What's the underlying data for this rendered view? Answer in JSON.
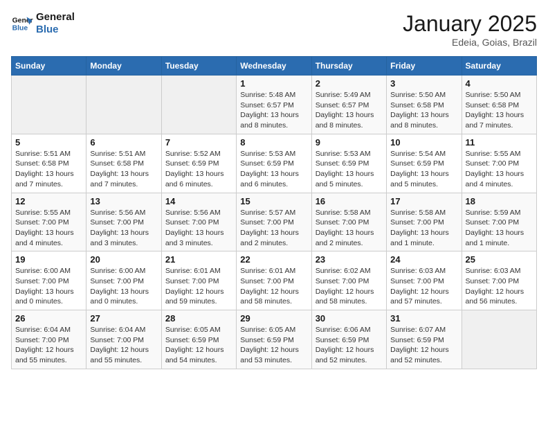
{
  "header": {
    "logo_line1": "General",
    "logo_line2": "Blue",
    "month_title": "January 2025",
    "subtitle": "Edeia, Goias, Brazil"
  },
  "days_of_week": [
    "Sunday",
    "Monday",
    "Tuesday",
    "Wednesday",
    "Thursday",
    "Friday",
    "Saturday"
  ],
  "weeks": [
    [
      {
        "day": "",
        "info": ""
      },
      {
        "day": "",
        "info": ""
      },
      {
        "day": "",
        "info": ""
      },
      {
        "day": "1",
        "info": "Sunrise: 5:48 AM\nSunset: 6:57 PM\nDaylight: 13 hours and 8 minutes."
      },
      {
        "day": "2",
        "info": "Sunrise: 5:49 AM\nSunset: 6:57 PM\nDaylight: 13 hours and 8 minutes."
      },
      {
        "day": "3",
        "info": "Sunrise: 5:50 AM\nSunset: 6:58 PM\nDaylight: 13 hours and 8 minutes."
      },
      {
        "day": "4",
        "info": "Sunrise: 5:50 AM\nSunset: 6:58 PM\nDaylight: 13 hours and 7 minutes."
      }
    ],
    [
      {
        "day": "5",
        "info": "Sunrise: 5:51 AM\nSunset: 6:58 PM\nDaylight: 13 hours and 7 minutes."
      },
      {
        "day": "6",
        "info": "Sunrise: 5:51 AM\nSunset: 6:58 PM\nDaylight: 13 hours and 7 minutes."
      },
      {
        "day": "7",
        "info": "Sunrise: 5:52 AM\nSunset: 6:59 PM\nDaylight: 13 hours and 6 minutes."
      },
      {
        "day": "8",
        "info": "Sunrise: 5:53 AM\nSunset: 6:59 PM\nDaylight: 13 hours and 6 minutes."
      },
      {
        "day": "9",
        "info": "Sunrise: 5:53 AM\nSunset: 6:59 PM\nDaylight: 13 hours and 5 minutes."
      },
      {
        "day": "10",
        "info": "Sunrise: 5:54 AM\nSunset: 6:59 PM\nDaylight: 13 hours and 5 minutes."
      },
      {
        "day": "11",
        "info": "Sunrise: 5:55 AM\nSunset: 7:00 PM\nDaylight: 13 hours and 4 minutes."
      }
    ],
    [
      {
        "day": "12",
        "info": "Sunrise: 5:55 AM\nSunset: 7:00 PM\nDaylight: 13 hours and 4 minutes."
      },
      {
        "day": "13",
        "info": "Sunrise: 5:56 AM\nSunset: 7:00 PM\nDaylight: 13 hours and 3 minutes."
      },
      {
        "day": "14",
        "info": "Sunrise: 5:56 AM\nSunset: 7:00 PM\nDaylight: 13 hours and 3 minutes."
      },
      {
        "day": "15",
        "info": "Sunrise: 5:57 AM\nSunset: 7:00 PM\nDaylight: 13 hours and 2 minutes."
      },
      {
        "day": "16",
        "info": "Sunrise: 5:58 AM\nSunset: 7:00 PM\nDaylight: 13 hours and 2 minutes."
      },
      {
        "day": "17",
        "info": "Sunrise: 5:58 AM\nSunset: 7:00 PM\nDaylight: 13 hours and 1 minute."
      },
      {
        "day": "18",
        "info": "Sunrise: 5:59 AM\nSunset: 7:00 PM\nDaylight: 13 hours and 1 minute."
      }
    ],
    [
      {
        "day": "19",
        "info": "Sunrise: 6:00 AM\nSunset: 7:00 PM\nDaylight: 13 hours and 0 minutes."
      },
      {
        "day": "20",
        "info": "Sunrise: 6:00 AM\nSunset: 7:00 PM\nDaylight: 13 hours and 0 minutes."
      },
      {
        "day": "21",
        "info": "Sunrise: 6:01 AM\nSunset: 7:00 PM\nDaylight: 12 hours and 59 minutes."
      },
      {
        "day": "22",
        "info": "Sunrise: 6:01 AM\nSunset: 7:00 PM\nDaylight: 12 hours and 58 minutes."
      },
      {
        "day": "23",
        "info": "Sunrise: 6:02 AM\nSunset: 7:00 PM\nDaylight: 12 hours and 58 minutes."
      },
      {
        "day": "24",
        "info": "Sunrise: 6:03 AM\nSunset: 7:00 PM\nDaylight: 12 hours and 57 minutes."
      },
      {
        "day": "25",
        "info": "Sunrise: 6:03 AM\nSunset: 7:00 PM\nDaylight: 12 hours and 56 minutes."
      }
    ],
    [
      {
        "day": "26",
        "info": "Sunrise: 6:04 AM\nSunset: 7:00 PM\nDaylight: 12 hours and 55 minutes."
      },
      {
        "day": "27",
        "info": "Sunrise: 6:04 AM\nSunset: 7:00 PM\nDaylight: 12 hours and 55 minutes."
      },
      {
        "day": "28",
        "info": "Sunrise: 6:05 AM\nSunset: 6:59 PM\nDaylight: 12 hours and 54 minutes."
      },
      {
        "day": "29",
        "info": "Sunrise: 6:05 AM\nSunset: 6:59 PM\nDaylight: 12 hours and 53 minutes."
      },
      {
        "day": "30",
        "info": "Sunrise: 6:06 AM\nSunset: 6:59 PM\nDaylight: 12 hours and 52 minutes."
      },
      {
        "day": "31",
        "info": "Sunrise: 6:07 AM\nSunset: 6:59 PM\nDaylight: 12 hours and 52 minutes."
      },
      {
        "day": "",
        "info": ""
      }
    ]
  ]
}
